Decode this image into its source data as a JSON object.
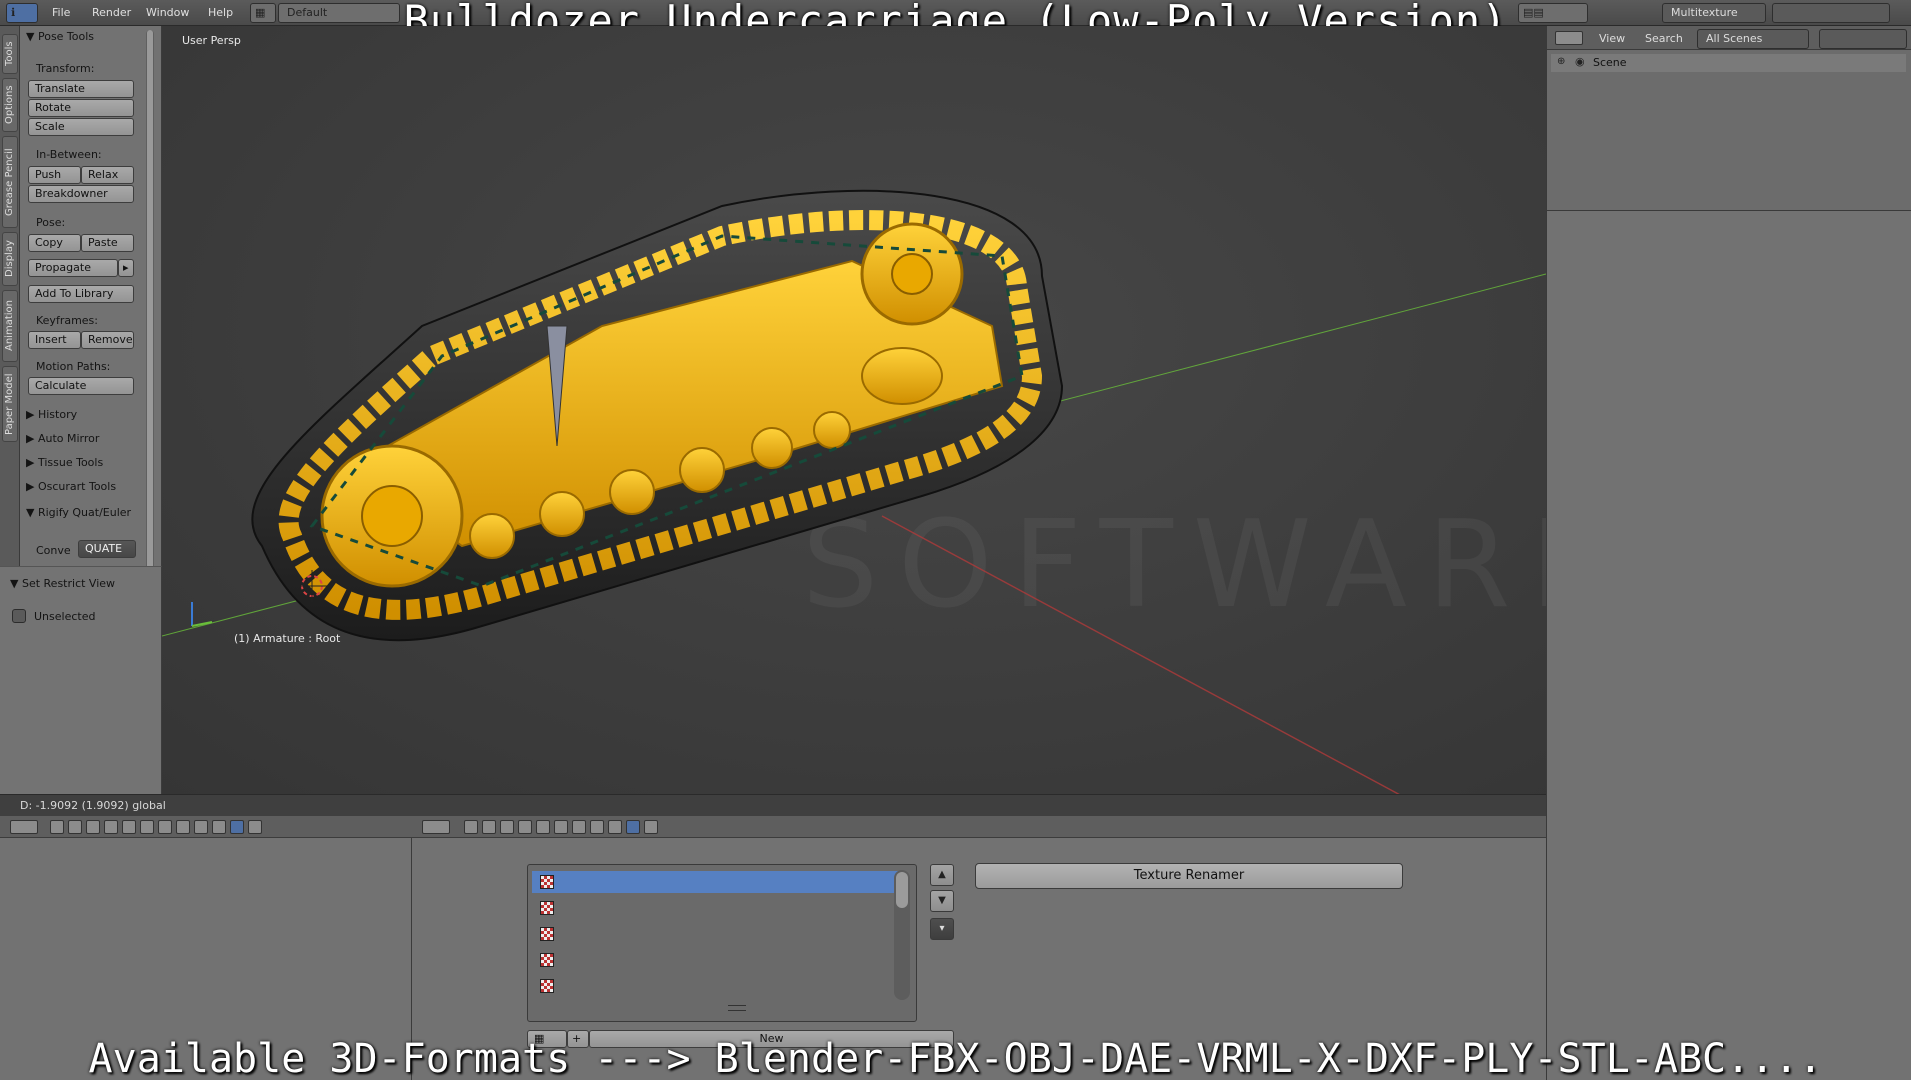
{
  "overlay": {
    "title": "Bulldozer Undercarriage (Low-Poly Version)",
    "subtitle": "Available 3D-Formats ---> Blender-FBX-OBJ-DAE-VRML-X-DXF-PLY-STL-ABC...."
  },
  "topbar": {
    "menus": [
      "File",
      "Render",
      "Window",
      "Help"
    ],
    "layout": "Default",
    "shading": "Multitexture"
  },
  "tabs": [
    "Tools",
    "Options",
    "Grease Pencil",
    "Display",
    "Animation",
    "Paper Model"
  ],
  "toolshelf": {
    "header": "Pose Tools",
    "transform_label": "Transform:",
    "translate": "Translate",
    "rotate": "Rotate",
    "scale": "Scale",
    "inbetween_label": "In-Between:",
    "push": "Push",
    "relax": "Relax",
    "breakdowner": "Breakdowner",
    "pose_label": "Pose:",
    "copy": "Copy",
    "paste": "Paste",
    "propagate": "Propagate",
    "add_to_library": "Add To Library",
    "keyframes_label": "Keyframes:",
    "insert": "Insert",
    "remove": "Remove",
    "motion_paths_label": "Motion Paths:",
    "calculate": "Calculate",
    "history": "History",
    "auto_mirror": "Auto Mirror",
    "tissue_tools": "Tissue Tools",
    "oscurart_tools": "Oscurart Tools",
    "rigify": "Rigify Quat/Euler",
    "conve_label": "Conve",
    "conve_value": "QUATE"
  },
  "restrict": {
    "header": "Set Restrict View",
    "unselected": "Unselected"
  },
  "viewport": {
    "view_label": "User Persp",
    "object_label": "(1) Armature : Root"
  },
  "status": {
    "text": "D: -1.9092 (1.9092) global"
  },
  "outliner": {
    "view": "View",
    "search": "Search",
    "scenes": "All Scenes",
    "scene": "Scene"
  },
  "texture": {
    "renamer": "Texture Renamer",
    "new_label": "New"
  },
  "colors": {
    "accent": "#5680c2",
    "model_yellow": "#f2b10a",
    "axis_green": "#6abf3a",
    "axis_red": "#b03a3a"
  }
}
